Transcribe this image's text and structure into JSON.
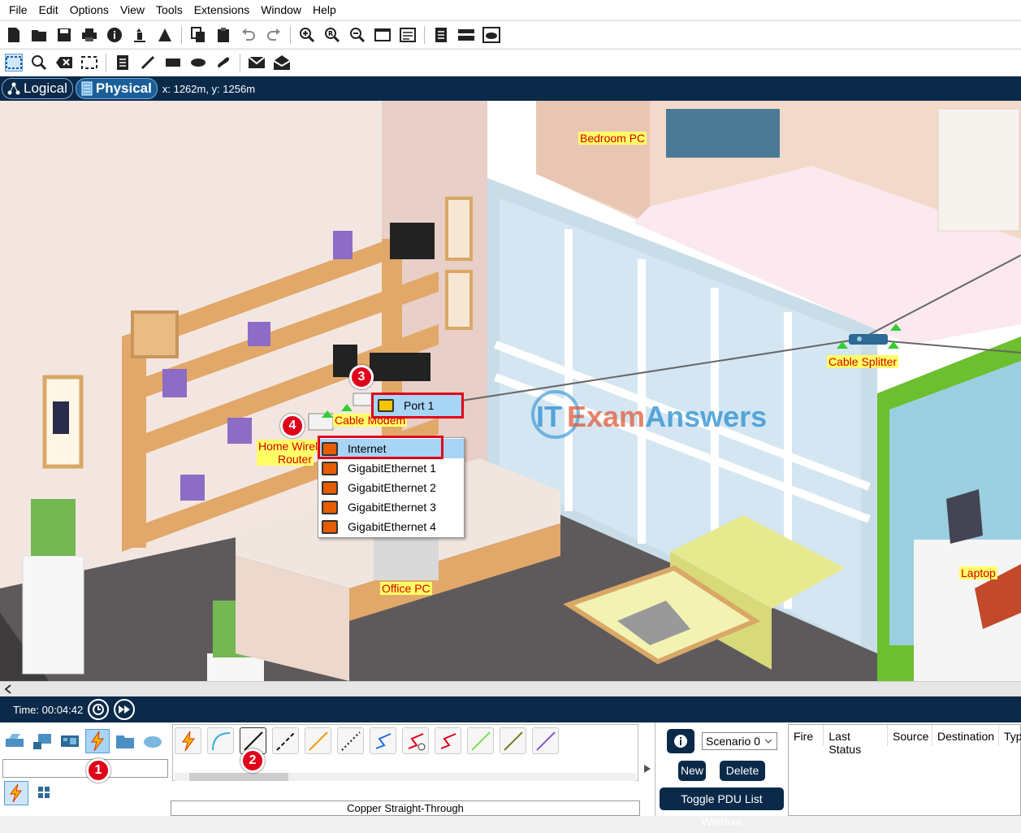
{
  "menu": [
    "File",
    "Edit",
    "Options",
    "View",
    "Tools",
    "Extensions",
    "Window",
    "Help"
  ],
  "nav": {
    "logical_label": "Logical",
    "physical_label": "Physical",
    "coords": "x: 1262m, y: 1256m"
  },
  "canvas": {
    "labels": {
      "bedroom_pc": "Bedroom PC",
      "cable_splitter": "Cable Splitter",
      "cable_modem": "Cable Modem",
      "home_router_line1": "Home Wirele",
      "home_router_line2": "Router",
      "office_pc": "Office PC",
      "laptop": "Laptop"
    },
    "port_popup": "Port 1",
    "context_menu": [
      "Internet",
      "GigabitEthernet 1",
      "GigabitEthernet 2",
      "GigabitEthernet 3",
      "GigabitEthernet 4"
    ],
    "watermark_it": "IT",
    "watermark_exam": "Exam",
    "watermark_answers": "Answers",
    "badges": [
      "1",
      "2",
      "3",
      "4"
    ]
  },
  "timebar": {
    "time": "Time: 00:04:42"
  },
  "bottom": {
    "scenario": "Scenario 0",
    "new_label": "New",
    "delete_label": "Delete",
    "toggle_label": "Toggle PDU List Window",
    "pdu_columns": [
      "Fire",
      "Last Status",
      "Source",
      "Destination",
      "Typ"
    ],
    "cable_label": "Copper Straight-Through"
  },
  "colors": {
    "navy": "#0b2a4a",
    "label_bg": "#ffff66",
    "label_text": "#d40000",
    "highlight": "#e0001b"
  }
}
